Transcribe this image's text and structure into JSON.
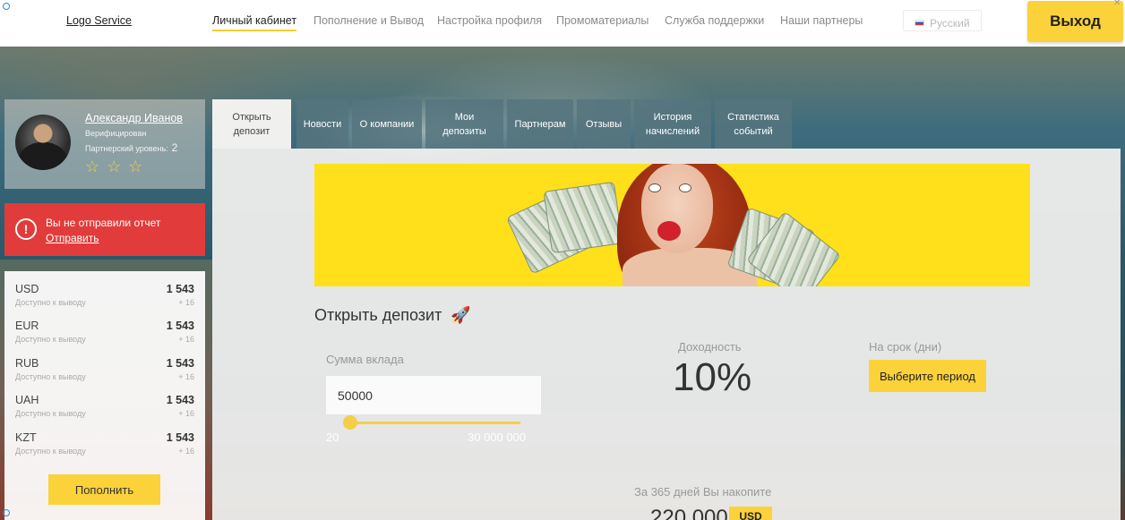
{
  "colors": {
    "accent": "#fbd23a",
    "alert": "#e23b3b",
    "tab_bg": "#56747e",
    "nav_active_underline": "#f7cf2b"
  },
  "header": {
    "logo": "Logo Service",
    "nav": [
      {
        "label": "Личный кабинет",
        "active": true
      },
      {
        "label": "Пополнение и Вывод",
        "active": false
      },
      {
        "label": "Настройка профиля",
        "active": false
      },
      {
        "label": "Промоматериалы",
        "active": false
      },
      {
        "label": "Служба поддержки",
        "active": false
      },
      {
        "label": "Наши партнеры",
        "active": false
      }
    ],
    "language": "Русский",
    "exit_label": "Выход"
  },
  "profile": {
    "name": "Александр Иванов",
    "status": "Верифицирован",
    "level_label": "Партнерский уровень:",
    "level_value": "2",
    "star_count": 3
  },
  "alert": {
    "icon": "!",
    "text": "Вы не отправили отчет",
    "link": "Отправить"
  },
  "balances": [
    {
      "currency": "USD",
      "sub": "Доступно к выводу",
      "amount": "1 543",
      "delta": "+ 16"
    },
    {
      "currency": "EUR",
      "sub": "Доступно к выводу",
      "amount": "1 543",
      "delta": "+ 16"
    },
    {
      "currency": "RUB",
      "sub": "Доступно к выводу",
      "amount": "1 543",
      "delta": "+ 16"
    },
    {
      "currency": "UAH",
      "sub": "Доступно к выводу",
      "amount": "1 543",
      "delta": "+ 16"
    },
    {
      "currency": "KZT",
      "sub": "Доступно к выводу",
      "amount": "1 543",
      "delta": "+ 16"
    }
  ],
  "topup_label": "Пополнить",
  "tabs": [
    {
      "line1": "Открыть",
      "line2": "депозит",
      "active": true
    },
    {
      "line1": "Новости",
      "line2": "",
      "active": false
    },
    {
      "line1": "О компании",
      "line2": "",
      "active": false
    },
    {
      "line1": "Мои",
      "line2": "депозиты",
      "active": false
    },
    {
      "line1": "Партнерам",
      "line2": "",
      "active": false
    },
    {
      "line1": "Отзывы",
      "line2": "",
      "active": false
    },
    {
      "line1": "История",
      "line2": "начислений",
      "active": false
    },
    {
      "line1": "Статистика",
      "line2": "событий",
      "active": false
    }
  ],
  "deposit": {
    "title": "Открыть депозит",
    "sum_label": "Сумма вклада",
    "sum_value": "50000",
    "slider_min": "20",
    "slider_max": "30 000 000",
    "yield_label": "Доходность",
    "yield_value": "10%",
    "term_label": "На срок (дни)",
    "period_button": "Выберите период",
    "accumulate_text": "За 365 дней Вы накопите",
    "accumulate_value": "220 000",
    "accumulate_currency": "USD"
  }
}
